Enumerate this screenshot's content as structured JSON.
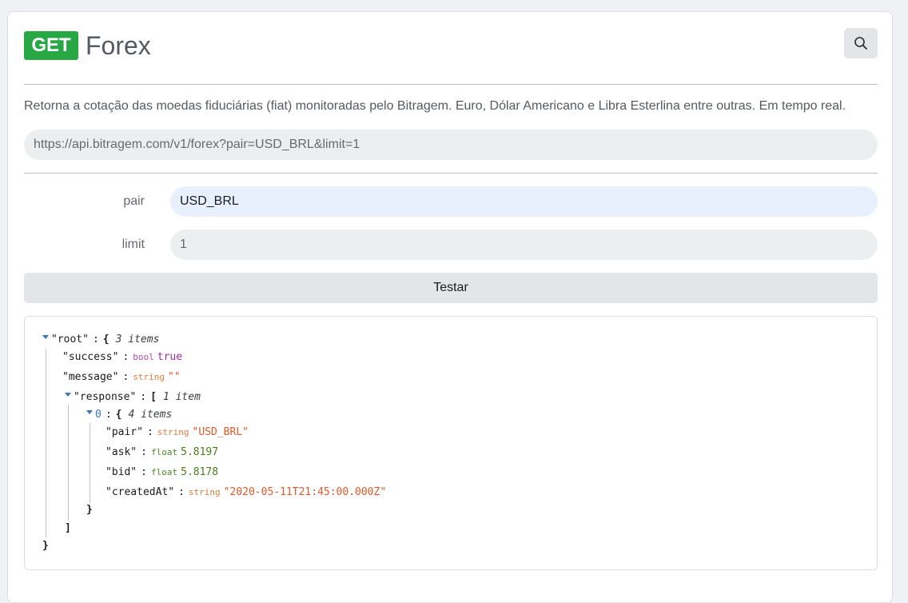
{
  "endpoint": {
    "method": "GET",
    "title": "Forex",
    "description": "Retorna a cotação das moedas fiduciárias (fiat) monitoradas pelo Bitragem. Euro, Dólar Americano e Libra Esterlina entre outras. Em tempo real.",
    "url": "https://api.bitragem.com/v1/forex?pair=USD_BRL&limit=1",
    "search_icon": "search-icon"
  },
  "params": [
    {
      "label": "pair",
      "value": "USD_BRL"
    },
    {
      "label": "limit",
      "value": "1"
    }
  ],
  "test_button": "Testar",
  "json_view": {
    "root": {
      "key": "\"root\"",
      "open": "{",
      "meta": "3 items",
      "close": "}"
    },
    "success": {
      "key": "\"success\"",
      "type": "bool",
      "value": "true"
    },
    "message": {
      "key": "\"message\"",
      "type": "string",
      "value": "\"\""
    },
    "response": {
      "key": "\"response\"",
      "open": "[",
      "meta": "1 item",
      "close": "]"
    },
    "item0": {
      "key": "0",
      "open": "{",
      "meta": "4 items",
      "close": "}"
    },
    "pair": {
      "key": "\"pair\"",
      "type": "string",
      "value": "\"USD_BRL\""
    },
    "ask": {
      "key": "\"ask\"",
      "type": "float",
      "value": "5.8197"
    },
    "bid": {
      "key": "\"bid\"",
      "type": "float",
      "value": "5.8178"
    },
    "createdAt": {
      "key": "\"createdAt\"",
      "type": "string",
      "value": "\"2020-05-11T21:45:00.000Z\""
    }
  },
  "colors": {
    "method_badge": "#28a745",
    "active_input": "#e8f0fe",
    "type_bool": "#b04fae",
    "type_string": "#e07d3f",
    "type_float": "#4c8a2c"
  }
}
